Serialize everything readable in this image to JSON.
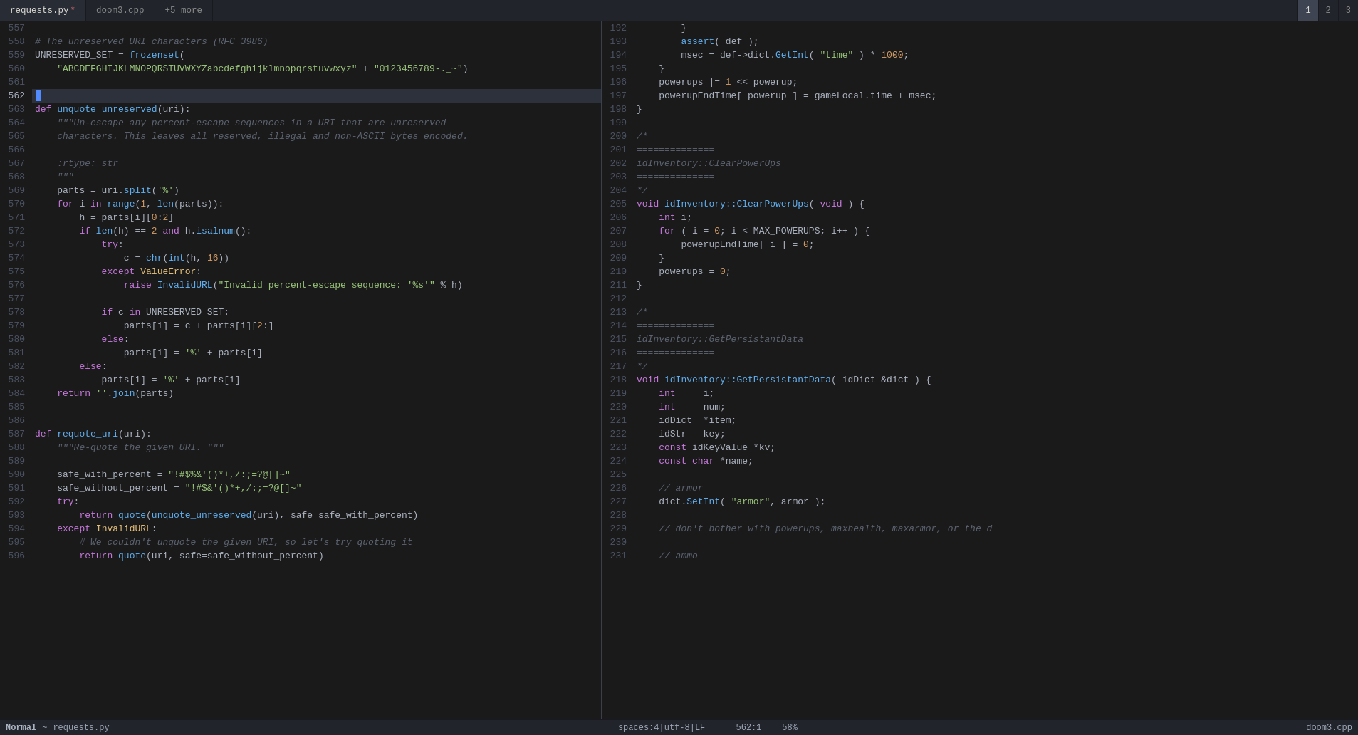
{
  "tabs": {
    "items": [
      {
        "label": "requests.py",
        "modified": true,
        "active": true
      },
      {
        "label": "doom3.cpp",
        "modified": false,
        "active": false
      },
      {
        "label": "+5 more",
        "modified": false,
        "active": false
      }
    ],
    "window_nums": [
      {
        "label": "1",
        "active": true
      },
      {
        "label": "2",
        "active": false
      },
      {
        "label": "3",
        "active": false
      }
    ]
  },
  "status_bar": {
    "mode": "Normal",
    "separator": "~",
    "left_file": "requests.py",
    "center": "spaces:4|utf-8|LF",
    "position": "562:1",
    "percent": "58%",
    "right_file": "doom3.cpp"
  }
}
